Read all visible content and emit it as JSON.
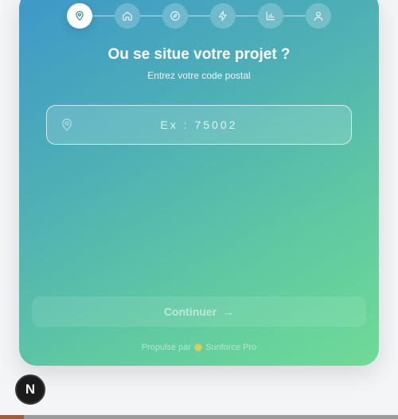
{
  "stepper": {
    "steps": [
      {
        "icon": "map-pin-icon",
        "active": true
      },
      {
        "icon": "home-icon",
        "active": false
      },
      {
        "icon": "compass-icon",
        "active": false
      },
      {
        "icon": "lightning-icon",
        "active": false
      },
      {
        "icon": "bar-chart-icon",
        "active": false
      },
      {
        "icon": "user-icon",
        "active": false
      }
    ]
  },
  "header": {
    "title": "Ou se situe votre projet ?",
    "subtitle": "Entrez votre code postal"
  },
  "postal": {
    "placeholder": "Ex : 75002",
    "value": ""
  },
  "continue_button": {
    "label": "Continuer",
    "enabled": false
  },
  "footer": {
    "prefix": "Propulsé par",
    "brand": "Sunforce Pro"
  },
  "badge": {
    "letter": "N"
  },
  "colors": {
    "gradient_start": "#3d98c9",
    "gradient_end": "#6fdb96",
    "active_step_icon": "#2c8c7c"
  }
}
